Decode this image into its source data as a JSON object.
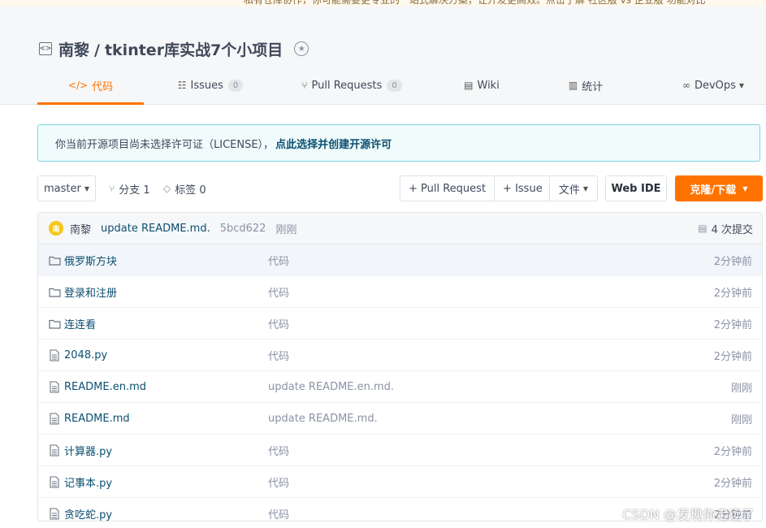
{
  "banner": {
    "text": "私有仓库协作，你可能需要更专业的一站式解决方案，让开发更高效。点击了解 社区版 vs 企业版 功能对比"
  },
  "repo": {
    "owner": "南黎",
    "separator": "/",
    "name": "tkinter库实战7个小项目"
  },
  "tabs": [
    {
      "label": "代码",
      "icon": "code-icon",
      "active": true
    },
    {
      "label": "Issues",
      "count": "0",
      "icon": "issues-icon"
    },
    {
      "label": "Pull Requests",
      "count": "0",
      "icon": "pull-request-icon"
    },
    {
      "label": "Wiki",
      "icon": "wiki-icon"
    },
    {
      "label": "统计",
      "icon": "stats-icon"
    },
    {
      "label": "DevOps",
      "icon": "devops-icon"
    }
  ],
  "license_notice": {
    "text": "你当前开源项目尚未选择许可证（LICENSE），",
    "link": "点此选择并创建开源许可"
  },
  "toolbar": {
    "branch": "master",
    "branches": "分支 1",
    "tags": "标签 0",
    "pull_request": "+ Pull Request",
    "issue": "+ Issue",
    "files": "文件",
    "web_ide": "Web IDE",
    "clone": "克隆/下载"
  },
  "commit": {
    "avatar_text": "南",
    "author": "南黎",
    "message": "update README.md.",
    "sha": "5bcd622",
    "time": "刚刚",
    "count": "4 次提交"
  },
  "files": [
    {
      "type": "folder",
      "name": "俄罗斯方块",
      "message": "代码",
      "time": "2分钟前"
    },
    {
      "type": "folder",
      "name": "登录和注册",
      "message": "代码",
      "time": "2分钟前"
    },
    {
      "type": "folder",
      "name": "连连看",
      "message": "代码",
      "time": "2分钟前"
    },
    {
      "type": "file",
      "name": "2048.py",
      "message": "代码",
      "time": "2分钟前"
    },
    {
      "type": "file",
      "name": "README.en.md",
      "message": "update README.en.md.",
      "time": "刚刚"
    },
    {
      "type": "file",
      "name": "README.md",
      "message": "update README.md.",
      "time": "刚刚"
    },
    {
      "type": "file",
      "name": "计算器.py",
      "message": "代码",
      "time": "2分钟前"
    },
    {
      "type": "file",
      "name": "记事本.py",
      "message": "代码",
      "time": "2分钟前"
    },
    {
      "type": "file",
      "name": "贪吃蛇.py",
      "message": "代码",
      "time": "2分钟前"
    }
  ],
  "watermark": "CSDN @发现你走远了",
  "colors": {
    "accent": "#fe7300",
    "link": "#0b4f70",
    "notice_border": "#7dd6de"
  }
}
